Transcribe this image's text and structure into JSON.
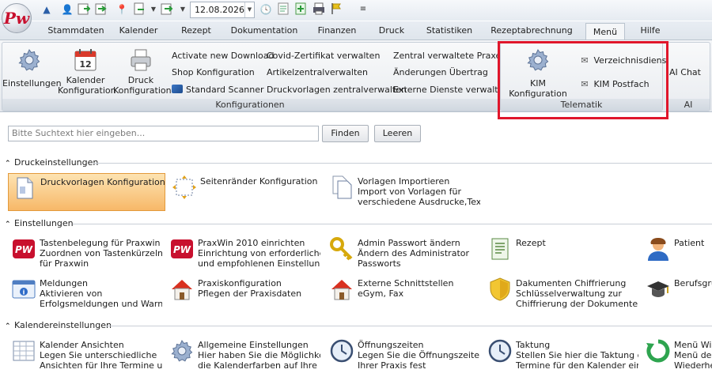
{
  "quick_access": {
    "date": "12.08.2026"
  },
  "tabs": [
    "Stammdaten",
    "Kalender",
    "Rezept",
    "Dokumentation",
    "Finanzen",
    "Druck",
    "Statistiken",
    "Rezeptabrechnung",
    "Menü",
    "Hilfe"
  ],
  "active_tab": "Menü",
  "ribbon": {
    "big_buttons": [
      {
        "line1": "Einstellungen",
        "line2": ""
      },
      {
        "line1": "Kalender",
        "line2": "Konfiguration"
      },
      {
        "line1": "Druck",
        "line2": "Konfiguration"
      }
    ],
    "col1": [
      "Activate new Download",
      "Shop Konfiguration",
      "Standard Scanner"
    ],
    "col2": [
      "Covid-Zertifikat verwalten",
      "Artikelzentralverwalten",
      "Druckvorlagen zentralverwalten"
    ],
    "col3": [
      "Zentral verwaltete Praxen",
      "Änderungen Übertrag",
      "Externe Dienste verwalten"
    ],
    "group1_label": "Konfigurationen",
    "kim_button": "KIM Konfiguration",
    "verzeichnisdienst": "Verzeichnisdienst",
    "kim_postfach": "KIM Postfach",
    "group2_label": "Telematik",
    "ai_chat": "AI Chat",
    "group3_label": "AI"
  },
  "search": {
    "placeholder": "Bitte Suchtext hier eingeben...",
    "find_label": "Finden",
    "clear_label": "Leeren"
  },
  "sections": {
    "druck": {
      "title": "Druckeinstellungen",
      "items": [
        {
          "l1": "Druckvorlagen Konfiguration",
          "l2": "",
          "l3": ""
        },
        {
          "l1": "Seitenränder Konfiguration",
          "l2": "",
          "l3": ""
        },
        {
          "l1": "Vorlagen Importieren",
          "l2": "Import von Vorlagen für",
          "l3": "verschiedene Ausdrucke,Text..."
        }
      ]
    },
    "einst": {
      "title": "Einstellungen",
      "items": [
        {
          "l1": "Tastenbelegung für Praxwin",
          "l2": "Zuordnen von Tastenkürzeln",
          "l3": "für Praxwin"
        },
        {
          "l1": "PraxWin 2010 einrichten",
          "l2": "Einrichtung von erforderlichen",
          "l3": "und empfohlenen Einstellungen"
        },
        {
          "l1": "Admin Passwort ändern",
          "l2": "Ändern des Administrator",
          "l3": "Passworts"
        },
        {
          "l1": "Rezept",
          "l2": "",
          "l3": ""
        },
        {
          "l1": "Patient",
          "l2": "",
          "l3": ""
        },
        {
          "l1": "Meldungen",
          "l2": "Aktivieren von",
          "l3": "Erfolgsmeldungen und Warnu..."
        },
        {
          "l1": "Praxiskonfiguration",
          "l2": "Pflegen der Praxisdaten",
          "l3": ""
        },
        {
          "l1": "Externe Schnittstellen",
          "l2": "eGym, Fax",
          "l3": ""
        },
        {
          "l1": "Dakumenten Chiffrierung",
          "l2": "Schlüsselverwaltung zur",
          "l3": "Chiffrierung der Dokumente"
        },
        {
          "l1": "Berufsgrup",
          "l2": "",
          "l3": ""
        }
      ]
    },
    "kal": {
      "title": "Kalendereinstellungen",
      "items": [
        {
          "l1": "Kalender Ansichten",
          "l2": "Legen Sie unterschiedliche",
          "l3": "Ansichten für Ihre Termine un..."
        },
        {
          "l1": "Allgemeine Einstellungen",
          "l2": "Hier haben Sie die Möglichkeit",
          "l3": "die Kalenderfarben auf Ihre in..."
        },
        {
          "l1": "Öffnungszeiten",
          "l2": "Legen Sie die Öffnungszeiten",
          "l3": "Ihrer Praxis fest"
        },
        {
          "l1": "Taktung",
          "l2": "Stellen Sie hier die Taktung der",
          "l3": "Termine für den Kalender ein"
        },
        {
          "l1": "Menü Wie",
          "l2": "Menü des",
          "l3": "Wiederher"
        }
      ]
    }
  },
  "colors": {
    "highlight": "#e0162b",
    "selected": "#f7b868",
    "accent": "#2b5fa8"
  }
}
